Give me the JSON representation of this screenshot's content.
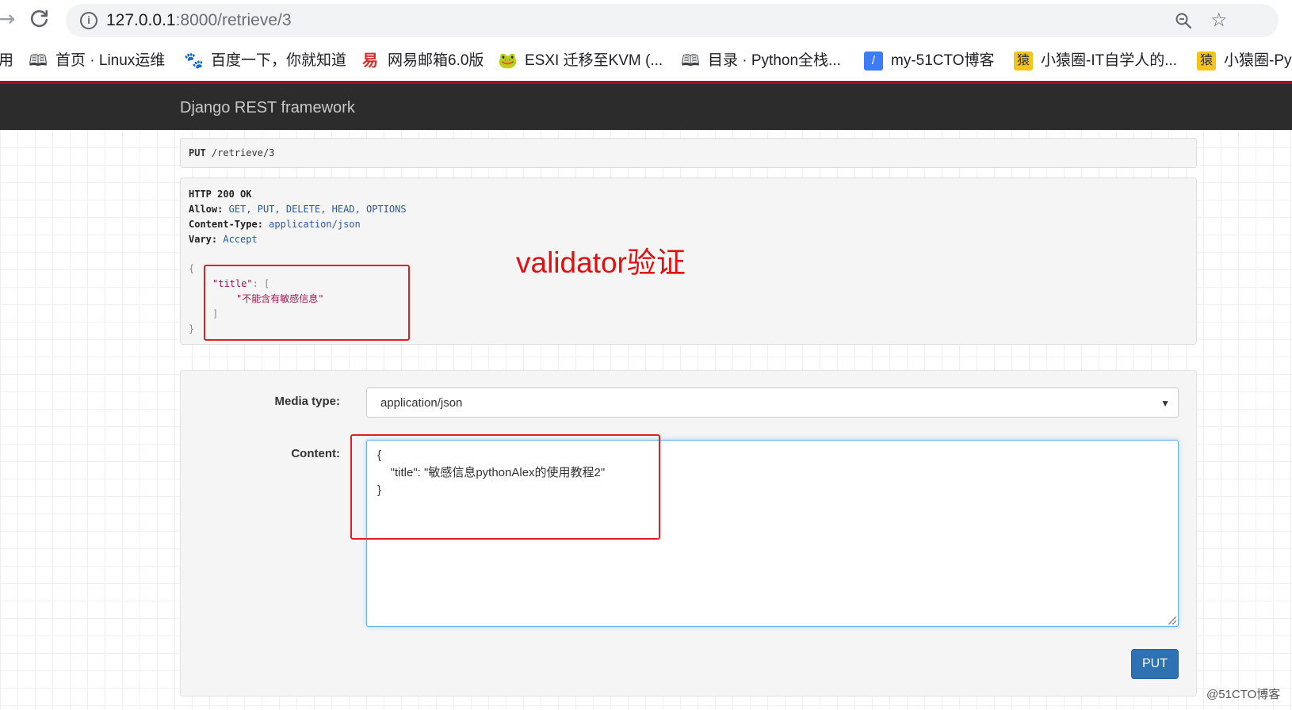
{
  "browser": {
    "url_host": "127.0.0.1",
    "url_rest": ":8000/retrieve/3",
    "bookmarks": [
      {
        "label": "用",
        "icon": "none"
      },
      {
        "label": "首页 · Linux运维",
        "icon": "book-icon"
      },
      {
        "label": "百度一下，你就知道",
        "icon": "baidu-paw-icon"
      },
      {
        "label": "网易邮箱6.0版",
        "icon": "netease-mail-icon"
      },
      {
        "label": "ESXI 迁移至KVM (...",
        "icon": "frog-icon"
      },
      {
        "label": "目录 · Python全栈...",
        "icon": "book-icon"
      },
      {
        "label": "my-51CTO博客",
        "icon": "51cto-icon"
      },
      {
        "label": "小猿圈-IT自学人的...",
        "icon": "yuanquan-icon"
      },
      {
        "label": "小猿圈-Py",
        "icon": "yuanquan-icon"
      }
    ],
    "bookmark_icon_glyphs": {
      "book": "🕮",
      "paw": "🐾",
      "mail": "易",
      "frog": "🐸",
      "cto": "/",
      "yuan": "猿"
    }
  },
  "navbar": {
    "brand": "Django REST framework"
  },
  "request": {
    "method": "PUT",
    "path": "/retrieve/3"
  },
  "response": {
    "status": "HTTP 200 OK",
    "allow_key": "Allow:",
    "allow_val": "GET, PUT, DELETE, HEAD, OPTIONS",
    "ctype_key": "Content-Type:",
    "ctype_val": "application/json",
    "vary_key": "Vary:",
    "vary_val": "Accept",
    "body_open": "{",
    "body_key": "\"title\"",
    "body_colon_bracket": ": [",
    "body_msg": "\"不能含有敏感信息\"",
    "body_close_bracket": "]",
    "body_close": "}"
  },
  "annotation": {
    "text": "validator验证"
  },
  "form": {
    "media_type_label": "Media type:",
    "media_type_value": "application/json",
    "content_label": "Content:",
    "content_lines": [
      "{",
      "    \"title\": \"敏感信息pythonAlex的使用教程2\"",
      "}"
    ],
    "submit_label": "PUT"
  },
  "watermark": "@51CTO博客",
  "colors": {
    "navbar": "#2c2c2c",
    "accent_red": "#a31515",
    "annotation_red": "#e02020",
    "button_blue": "#2f72b4",
    "string_red": "#a3154e",
    "value_blue": "#2b58a8"
  }
}
